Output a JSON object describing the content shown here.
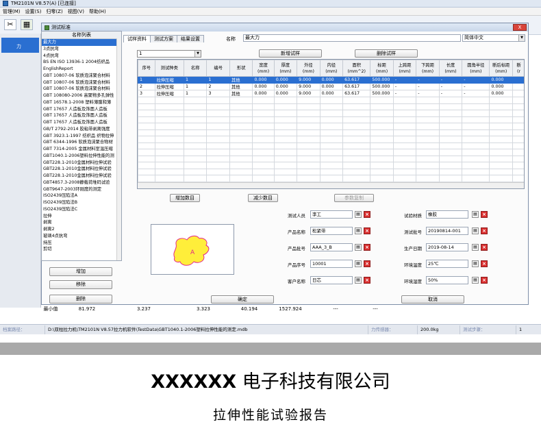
{
  "window": {
    "title": "TM2101N V8.57(A)  [已连接]"
  },
  "menu": [
    "管理(M)",
    "设置(S)",
    "归零(Z)",
    "视图(V)",
    "帮助(H)"
  ],
  "dialog": {
    "title": "测试标准",
    "close_label": "X"
  },
  "left_panel": {
    "selected": "力"
  },
  "standards": {
    "header": "名称列表",
    "items": [
      "最大力",
      "3点抗弯",
      "4点抗弯",
      "BS EN ISO 13936-1 2004纺织品",
      "EnglishReport",
      "GBT 10807-06 软质泡沫聚合材料",
      "GBT 10807-06 软质泡沫聚合材料",
      "GBT 10807-06 软质泡沫聚合材料",
      "GBT 108080-2006 高聚物多孔弹性",
      "GBT 16578.1-2008 塑料薄膜和薄",
      "GBT 17657 人造板及饰面人造板",
      "GBT 17657 人造板及饰面人造板",
      "GBT 17657 人造板及饰面人造板",
      "GB/T 2792-2014 胶粘带剥离强度",
      "GBT 3923.1-1997 纺织品 织物拉伸",
      "GBT 6344-1996 软质泡沫聚合物材",
      "GBT 7314-2005 金属材料室温压缩",
      "GBT1040.1-2006塑料拉伸性能的测",
      "GBT228.1-2010金属材料拉伸试验",
      "GBT228.1-2010金属材料拉伸试验",
      "GBT228.1-2010金属材料拉伸试验",
      "GBT4857.3-2008静载荷堆码试验",
      "GBT9647-2003环刚度的测定",
      "ISO2439压陷法A",
      "ISO2439压陷法B",
      "ISO2439压陷法C",
      "拉伸",
      "剥离",
      "剥离2",
      "玻璃4点抗弯",
      "持压",
      "剪切"
    ],
    "selected_index": 0
  },
  "left_buttons": {
    "add": "增加",
    "remove": "移除",
    "delete": "删除"
  },
  "tabs": [
    "试样资料",
    "测试方案",
    "结果设置"
  ],
  "name_field": {
    "label": "名称",
    "value": "最大力"
  },
  "language": "简体中文",
  "sample_count": "1",
  "buttons": {
    "new_sample": "新增试样",
    "delete_sample": "删除试样",
    "add_count": "增加数目",
    "reduce_count": "减少数目",
    "copy_params": "参数复制",
    "ok": "确定",
    "cancel": "取消"
  },
  "grid": {
    "headers": [
      "序号",
      "测试种类",
      "名称",
      "编号",
      "形状",
      "宽度\n(mm)",
      "厚度\n(mm)",
      "外径\n(mm)",
      "内径\n(mm)",
      "面积\n(mm^2)",
      "标距\n(mm)",
      "上跨距\n(mm)",
      "下跨距\n(mm)",
      "长度\n(mm)",
      "圆角半径\n(mm)",
      "断后标距\n(mm)",
      "断\n(r"
    ],
    "rows": [
      [
        "1",
        "拉伸压缩",
        "1",
        "1",
        "其他",
        "0.000",
        "0.000",
        "9.000",
        "0.000",
        "63.617",
        "500.000",
        "-",
        "-",
        "-",
        "-",
        "0.000",
        ""
      ],
      [
        "2",
        "拉伸压缩",
        "1",
        "2",
        "其他",
        "0.000",
        "0.000",
        "9.000",
        "0.000",
        "63.617",
        "500.000",
        "-",
        "-",
        "-",
        "-",
        "0.000",
        ""
      ],
      [
        "3",
        "拉伸压缩",
        "1",
        "3",
        "其他",
        "0.000",
        "0.000",
        "9.000",
        "0.000",
        "63.617",
        "500.000",
        "-",
        "-",
        "-",
        "-",
        "0.000",
        ""
      ]
    ],
    "selected_row": 0
  },
  "preview": {
    "label": "A"
  },
  "form_left": [
    {
      "label": "测试人员",
      "value": "李工"
    },
    {
      "label": "产品名称",
      "value": "松紧带"
    },
    {
      "label": "产品批号",
      "value": "AAA_3_B"
    },
    {
      "label": "产品序号",
      "value": "10001"
    },
    {
      "label": "客户名称",
      "value": "日芯"
    }
  ],
  "form_right": [
    {
      "label": "试验材质",
      "value": "橡胶"
    },
    {
      "label": "测试批号",
      "value": "20190814-001"
    },
    {
      "label": "生产日期",
      "value": "2019-08-14"
    },
    {
      "label": "环境温度",
      "value": "25℃"
    },
    {
      "label": "环境湿度",
      "value": "50%"
    }
  ],
  "bottom_row": {
    "label": "最小值",
    "values": [
      "81.972",
      "3.237",
      "3.323",
      "40.194",
      "1527.924",
      "---",
      "---"
    ]
  },
  "status": {
    "path_label": "档案路径：",
    "path": "D:\\双柱拉力机\\TM2101N V8.57拉力机软件\\TestData\\GBT1040.1-2006塑料拉伸性能的测定.mdb",
    "sensor_label": "力传感器：",
    "sensor_value": "200.0kg",
    "step_label": "测试步骤：",
    "step_value": "1"
  },
  "report": {
    "company_bold": "XXXXXX",
    "company_rest": " 电子科技有限公司",
    "title": "拉伸性能试验报告"
  },
  "colors": {
    "selection": "#2a6fd1",
    "shape_fill": "#ffee3a",
    "shape_stroke": "#e2258a",
    "close_red": "#d92e2e"
  }
}
